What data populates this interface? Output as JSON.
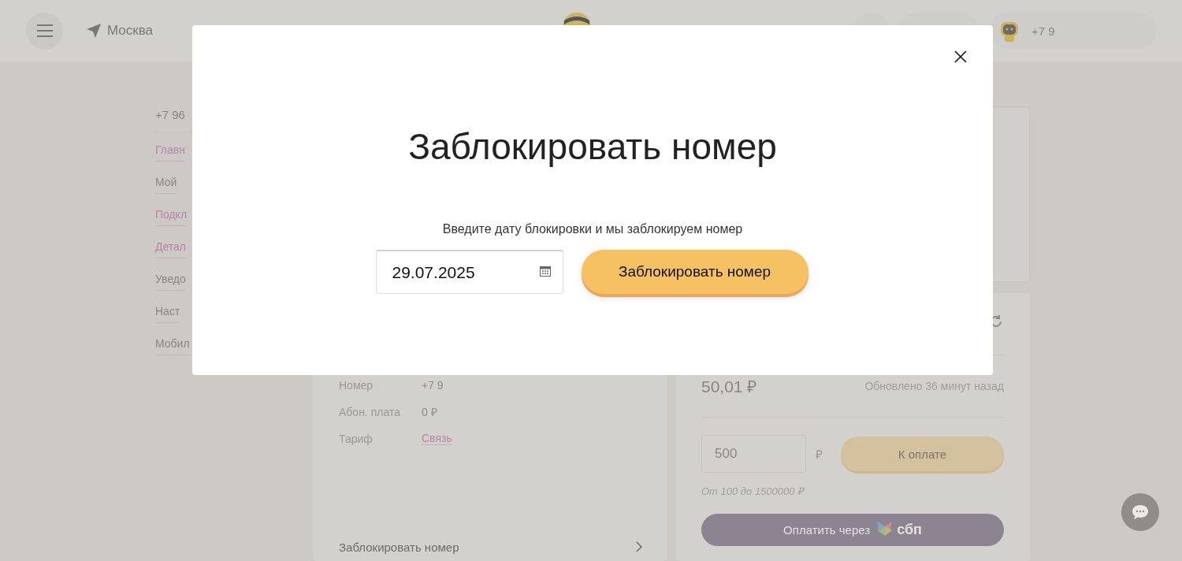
{
  "header": {
    "city": "Москва",
    "profile_number": "+7 9"
  },
  "nav": {
    "phone": "+7 96",
    "items": [
      {
        "label": "Главн",
        "kind": "link"
      },
      {
        "label": "Мой",
        "kind": "plain"
      },
      {
        "label": "Подкл",
        "kind": "link"
      },
      {
        "label": "Детал",
        "kind": "link"
      },
      {
        "label": "Уведо",
        "kind": "plain"
      },
      {
        "label": "Наст",
        "kind": "plain"
      },
      {
        "label": "Мобил",
        "kind": "plain"
      }
    ]
  },
  "info_rows": [
    {
      "label": "Номер",
      "value": "+7 9",
      "kind": "text"
    },
    {
      "label": "Абон. плата",
      "value": "0 ₽",
      "kind": "text"
    },
    {
      "label": "Тариф",
      "value": "Связь",
      "kind": "link"
    }
  ],
  "block_link": "Заблокировать номер",
  "balance": {
    "amount": "50,01 ₽",
    "updated": "Обновлено 36 минут назад"
  },
  "payment": {
    "amount": "500",
    "currency": "₽",
    "button": "К оплате",
    "hint": "От 100 до 1500000 ₽",
    "sbp_button": "Оплатить через",
    "sbp_logo": "сбп"
  },
  "modal": {
    "title": "Заблокировать номер",
    "subtitle": "Введите дату блокировки и мы заблокируем номер",
    "date": "29.07.2025",
    "button": "Заблокировать номер"
  }
}
